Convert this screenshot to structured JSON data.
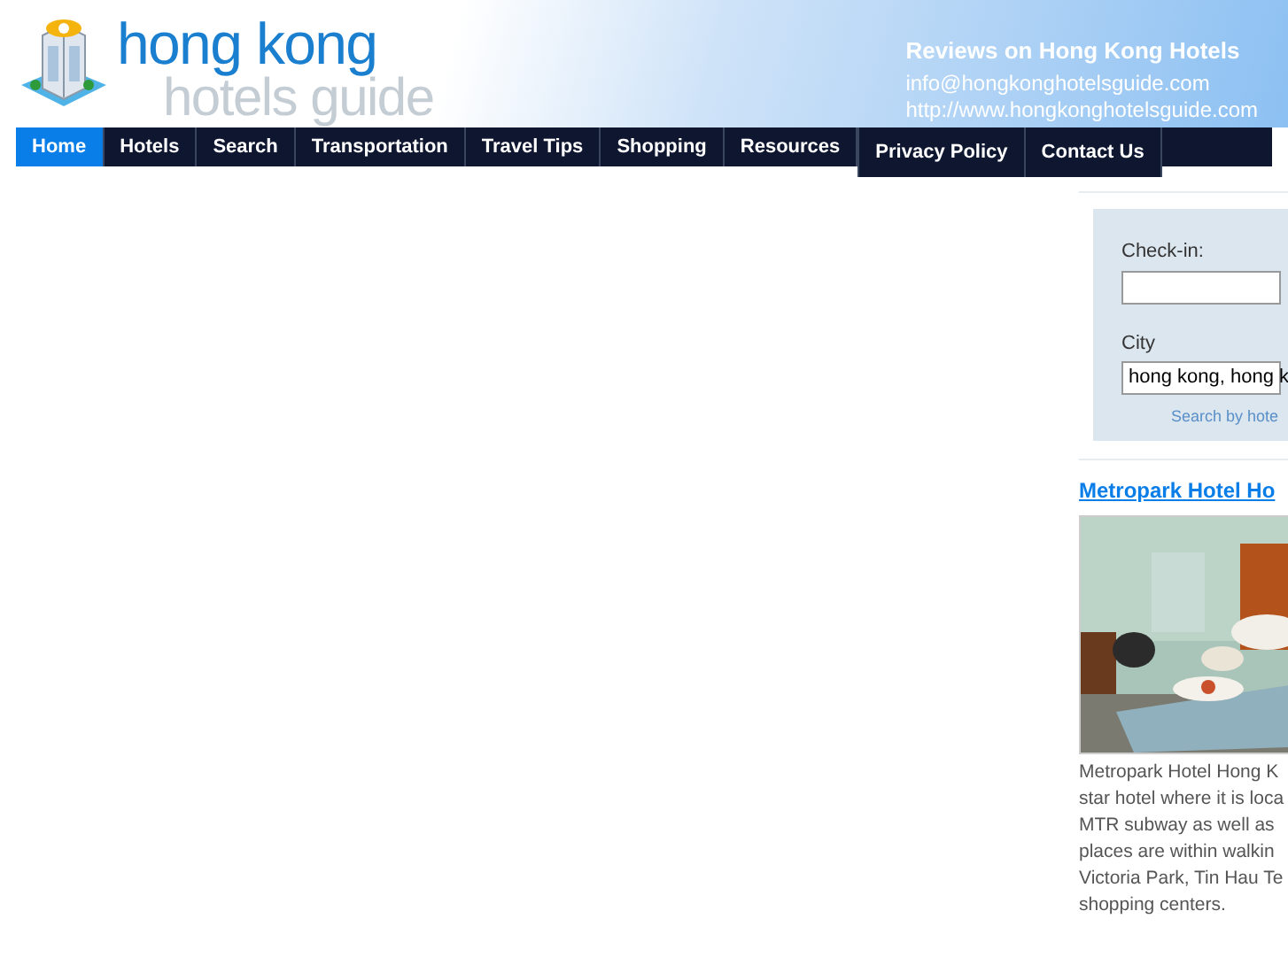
{
  "header": {
    "logo_line_1": "hong kong",
    "logo_line_2": "hotels guide",
    "tagline": "Reviews on Hong Kong Hotels",
    "email": "info@hongkonghotelsguide.com",
    "website": "http://www.hongkonghotelsguide.com"
  },
  "nav": [
    {
      "label": "Home",
      "selected": true
    },
    {
      "label": "Hotels",
      "selected": false
    },
    {
      "label": "Search",
      "selected": false
    },
    {
      "label": "Transportation",
      "selected": false
    },
    {
      "label": "Travel Tips",
      "selected": false
    },
    {
      "label": "Shopping",
      "selected": false
    },
    {
      "label": "Resources",
      "selected": false
    }
  ],
  "nav_row_2": [
    {
      "label": "Privacy Policy",
      "selected": false
    },
    {
      "label": "Contact Us",
      "selected": false
    }
  ],
  "search_box": {
    "checkin_label": "Check-in:",
    "city_label": "City",
    "city_value": "hong kong, hong k",
    "search_link": "Search by hote"
  },
  "hotel": {
    "title": "Metropark Hotel Ho",
    "description_lines": [
      "Metropark Hotel Hong K",
      "star hotel where it is loca",
      "MTR subway as well as",
      "places are within walkin",
      "Victoria Park, Tin Hau Te",
      "shopping centers."
    ]
  }
}
